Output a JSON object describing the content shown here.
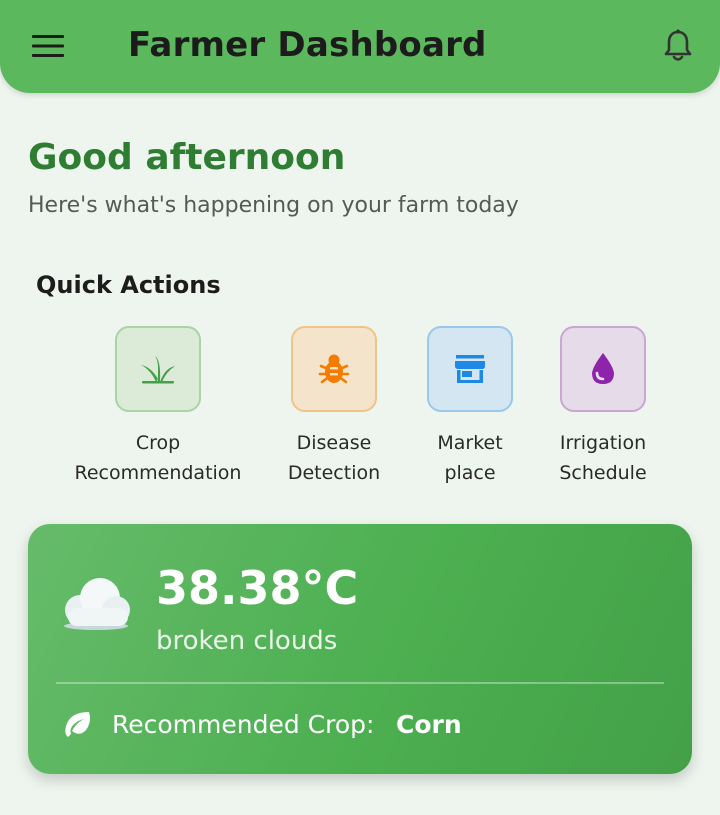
{
  "app_bar": {
    "title": "Farmer Dashboard",
    "menu_icon": "menu-icon",
    "bell_icon": "bell-icon",
    "background_color": "#5cb85c"
  },
  "greeting": {
    "title": "Good afternoon",
    "subtitle": "Here's what's happening on your farm today"
  },
  "quick_actions": {
    "title": "Quick Actions",
    "items": [
      {
        "label_line1": "Crop",
        "label_line2": "Recommendation",
        "icon": "sprout-icon",
        "tile_bg": "#dcebd8",
        "tile_border": "#a9d4a6",
        "icon_color": "#43a047"
      },
      {
        "label_line1": "Disease",
        "label_line2": "Detection",
        "icon": "bug-icon",
        "tile_bg": "#f4e4cb",
        "tile_border": "#f0c488",
        "icon_color": "#f57c00"
      },
      {
        "label_line1": "Market",
        "label_line2": "place",
        "icon": "store-icon",
        "tile_bg": "#d4e6f1",
        "tile_border": "#99c8ea",
        "icon_color": "#1e88e5"
      },
      {
        "label_line1": "Irrigation",
        "label_line2": "Schedule",
        "icon": "water-drop-icon",
        "tile_bg": "#e6dce9",
        "tile_border": "#c9a6d4",
        "icon_color": "#8e24aa"
      }
    ]
  },
  "weather": {
    "temperature": "38.38°C",
    "condition": "broken clouds",
    "icon": "cloud-icon",
    "recommended_label": "Recommended Crop:",
    "recommended_crop": "Corn",
    "recommended_icon": "leaf-icon"
  }
}
